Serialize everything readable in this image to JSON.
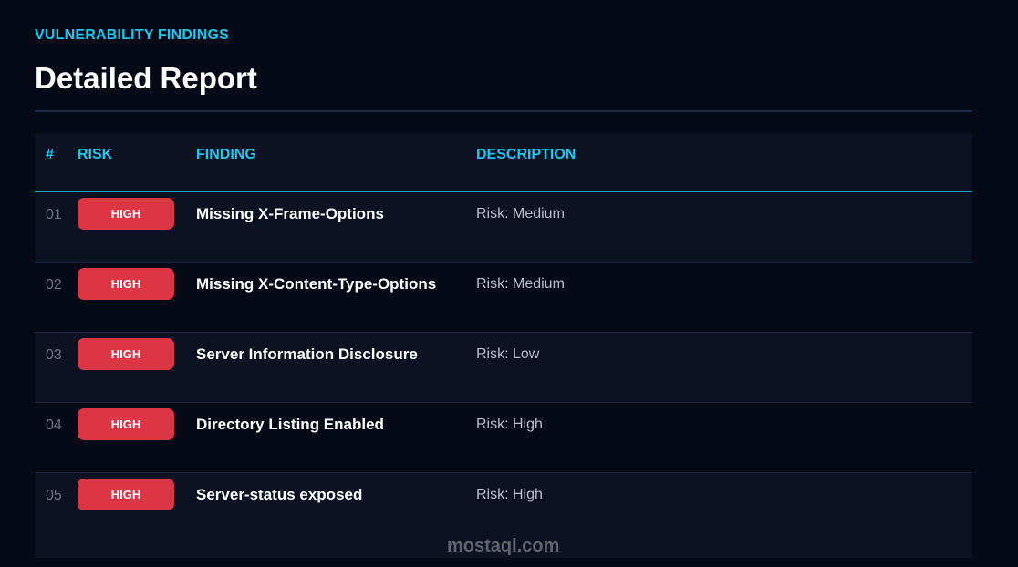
{
  "header": {
    "eyebrow": "VULNERABILITY FINDINGS",
    "title": "Detailed Report"
  },
  "table": {
    "columns": [
      "#",
      "RISK",
      "FINDING",
      "DESCRIPTION"
    ],
    "rows": [
      {
        "num": "01",
        "risk": "HIGH",
        "finding": "Missing X-Frame-Options",
        "description": "Risk: Medium"
      },
      {
        "num": "02",
        "risk": "HIGH",
        "finding": "Missing X-Content-Type-Options",
        "description": "Risk: Medium"
      },
      {
        "num": "03",
        "risk": "HIGH",
        "finding": "Server Information Disclosure",
        "description": "Risk: Low"
      },
      {
        "num": "04",
        "risk": "HIGH",
        "finding": "Directory Listing Enabled",
        "description": "Risk: High"
      },
      {
        "num": "05",
        "risk": "HIGH",
        "finding": "Server-status exposed",
        "description": "Risk: High"
      }
    ]
  },
  "watermark": "mostaql.com",
  "colors": {
    "accent": "#1ec8f0",
    "badge_high": "#dc3545",
    "background": "#060a16",
    "row_alt": "#0d1222"
  }
}
